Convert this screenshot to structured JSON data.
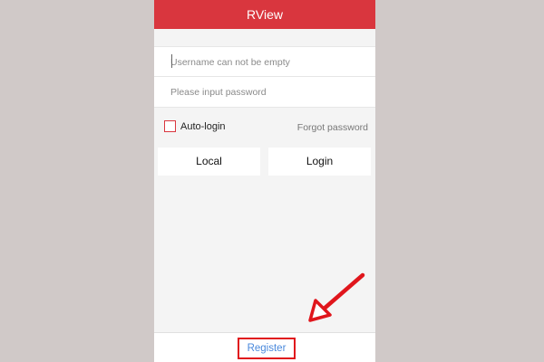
{
  "app": {
    "title": "RView"
  },
  "login_form": {
    "username_placeholder": "Username can not be empty",
    "username_value": "",
    "password_placeholder": "Please input password",
    "password_value": ""
  },
  "options": {
    "autologin_label": "Auto-login",
    "autologin_checked": false,
    "forgot_password_label": "Forgot password"
  },
  "actions": {
    "local_label": "Local",
    "login_label": "Login"
  },
  "footer": {
    "register_label": "Register"
  },
  "colors": {
    "accent_red": "#d9363e",
    "link_blue": "#4a89dc",
    "highlight_red": "#e0161c"
  },
  "icons": {
    "annotation_arrow": "arrow-pointing-down-left"
  }
}
